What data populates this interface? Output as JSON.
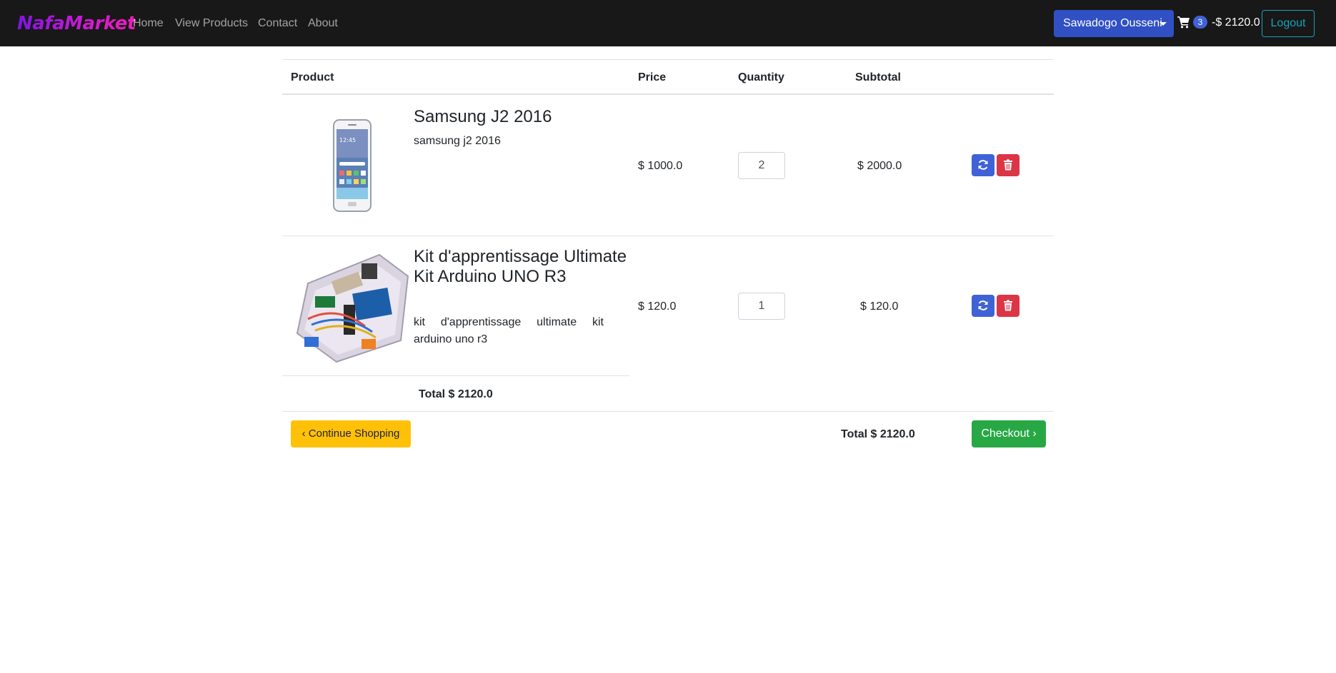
{
  "navbar": {
    "brand": "NafaMarket",
    "links": [
      "Home",
      "View Products",
      "Contact",
      "About"
    ],
    "user_name": "Sawadogo Ousseni",
    "cart_count": "3",
    "cart_total": "-$ 2120.0",
    "logout_label": "Logout"
  },
  "table": {
    "headers": {
      "product": "Product",
      "price": "Price",
      "quantity": "Quantity",
      "subtotal": "Subtotal"
    },
    "rows": [
      {
        "name": "Samsung J2 2016",
        "description": "samsung j2 2016",
        "price": "$ 1000.0",
        "quantity": "2",
        "subtotal": "$ 2000.0"
      },
      {
        "name": "Kit d'apprentissage Ultimate Kit Arduino UNO R3",
        "description": "kit d'apprentissage ultimate kit arduino uno r3",
        "price": "$ 120.0",
        "quantity": "1",
        "subtotal": "$ 120.0"
      }
    ],
    "total_label": "Total $ 2120.0"
  },
  "footer": {
    "continue_label": "Continue Shopping",
    "total_label": "Total $ 2120.0",
    "checkout_label": "Checkout"
  },
  "colors": {
    "navbar_bg": "#181818",
    "primary": "#3050c4",
    "danger": "#dc3545",
    "warning": "#ffc107",
    "success": "#28a745",
    "info": "#17a2b8"
  }
}
